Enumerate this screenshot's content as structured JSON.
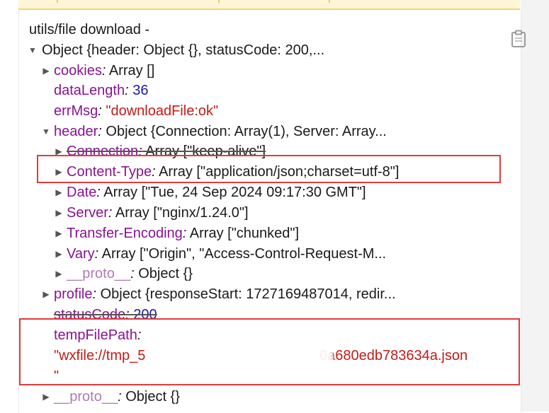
{
  "log": {
    "title": "utils/file download -",
    "root": {
      "label": "Object {header: Object {}, statusCode: 200,..."
    },
    "cookies": {
      "key": "cookies",
      "sep": ":",
      "value": " Array []"
    },
    "dataLength": {
      "key": "dataLength",
      "sep": ":",
      "value": "36"
    },
    "errMsg": {
      "key": "errMsg",
      "sep": ":",
      "value": "\"downloadFile:ok\""
    },
    "header": {
      "key": "header",
      "sep": ":",
      "value": " Object {Connection: Array(1), Server: Array...",
      "connection": {
        "key": "Connection",
        "sep": ":",
        "value": " Array [\"keep-alive\"]"
      },
      "content_type": {
        "key": "Content-Type",
        "sep": ":",
        "value": " Array [\"application/json;charset=utf-8\"]"
      },
      "date": {
        "key": "Date",
        "sep": ":",
        "value": " Array [\"Tue, 24 Sep 2024 09:17:30 GMT\"]"
      },
      "server": {
        "key": "Server",
        "sep": ":",
        "value": " Array [\"nginx/1.24.0\"]"
      },
      "transfer_encoding": {
        "key": "Transfer-Encoding",
        "sep": ":",
        "value": " Array [\"chunked\"]"
      },
      "vary": {
        "key": "Vary",
        "sep": ":",
        "value": " Array [\"Origin\", \"Access-Control-Request-M..."
      },
      "proto": {
        "key": "__proto__",
        "sep": ":",
        "value": " Object {}"
      }
    },
    "profile": {
      "key": "profile",
      "sep": ":",
      "value": " Object {responseStart: 1727169487014, redir..."
    },
    "statusCode": {
      "key": "statusCode",
      "sep": ":",
      "value": "200"
    },
    "tempFilePath": {
      "key": "tempFilePath",
      "sep": ":",
      "value_start": "\"wxfile://tmp_5",
      "value_end": "0a680edb783634a.json",
      "value_close": "\""
    },
    "proto": {
      "key": "__proto__",
      "sep": ":",
      "value": " Object {}"
    }
  },
  "colors": {
    "key": "#881391",
    "number": "#1a1aa6",
    "string": "#c41a16",
    "highlight": "#e03b3b"
  },
  "icons": {
    "copy": "clipboard-icon",
    "expand": "triangle-right-icon",
    "collapse": "triangle-down-icon"
  }
}
